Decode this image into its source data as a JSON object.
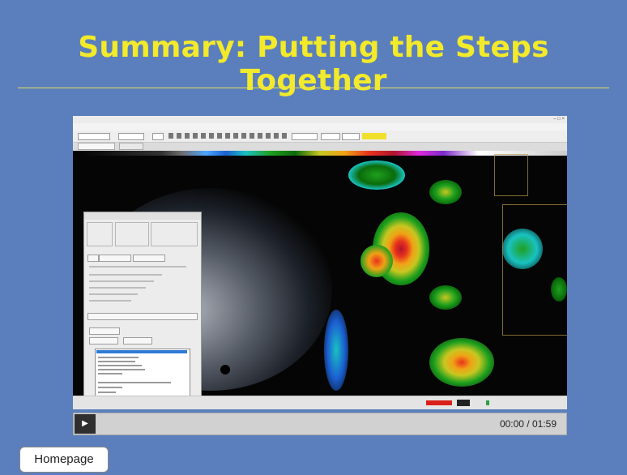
{
  "slide": {
    "title": "Summary: Putting the Steps Together"
  },
  "video": {
    "time_display": "00:00 / 01:59",
    "play_icon": "play-icon",
    "description": "Embedded screen recording of the weather warning software showing radar imagery and a warning generation dialog"
  },
  "navigation": {
    "homepage_label": "Homepage"
  },
  "colors": {
    "background": "#5b7fbc",
    "title": "#f2ea2a",
    "toolbar_highlight": "#f0e02c",
    "status_red": "#d9201b"
  }
}
